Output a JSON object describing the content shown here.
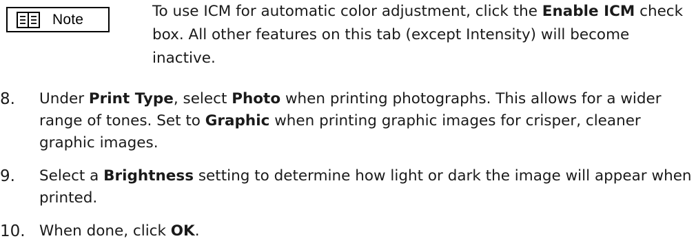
{
  "note": {
    "badge_label": "Note",
    "icon": "book-icon",
    "text_before": "To use ICM for automatic color adjustment, click the ",
    "text_bold": "Enable ICM",
    "text_after": " check box. All other features on this tab (except Intensity) will become inactive."
  },
  "steps": [
    {
      "number": "8.",
      "t1": "Under ",
      "b1": "Print Type",
      "t2": ", select ",
      "b2": "Photo",
      "t3": " when printing photographs. This allows for a wider range of tones. Set to ",
      "b3": "Graphic",
      "t4": " when printing graphic images for crisper, cleaner graphic images."
    },
    {
      "number": "9.",
      "t1": "Select a ",
      "b1": "Brightness",
      "t2": " setting to determine how light or dark the image will appear when printed."
    },
    {
      "number": "10.",
      "t1": "When done, click ",
      "b1": "OK",
      "t2": "."
    }
  ]
}
